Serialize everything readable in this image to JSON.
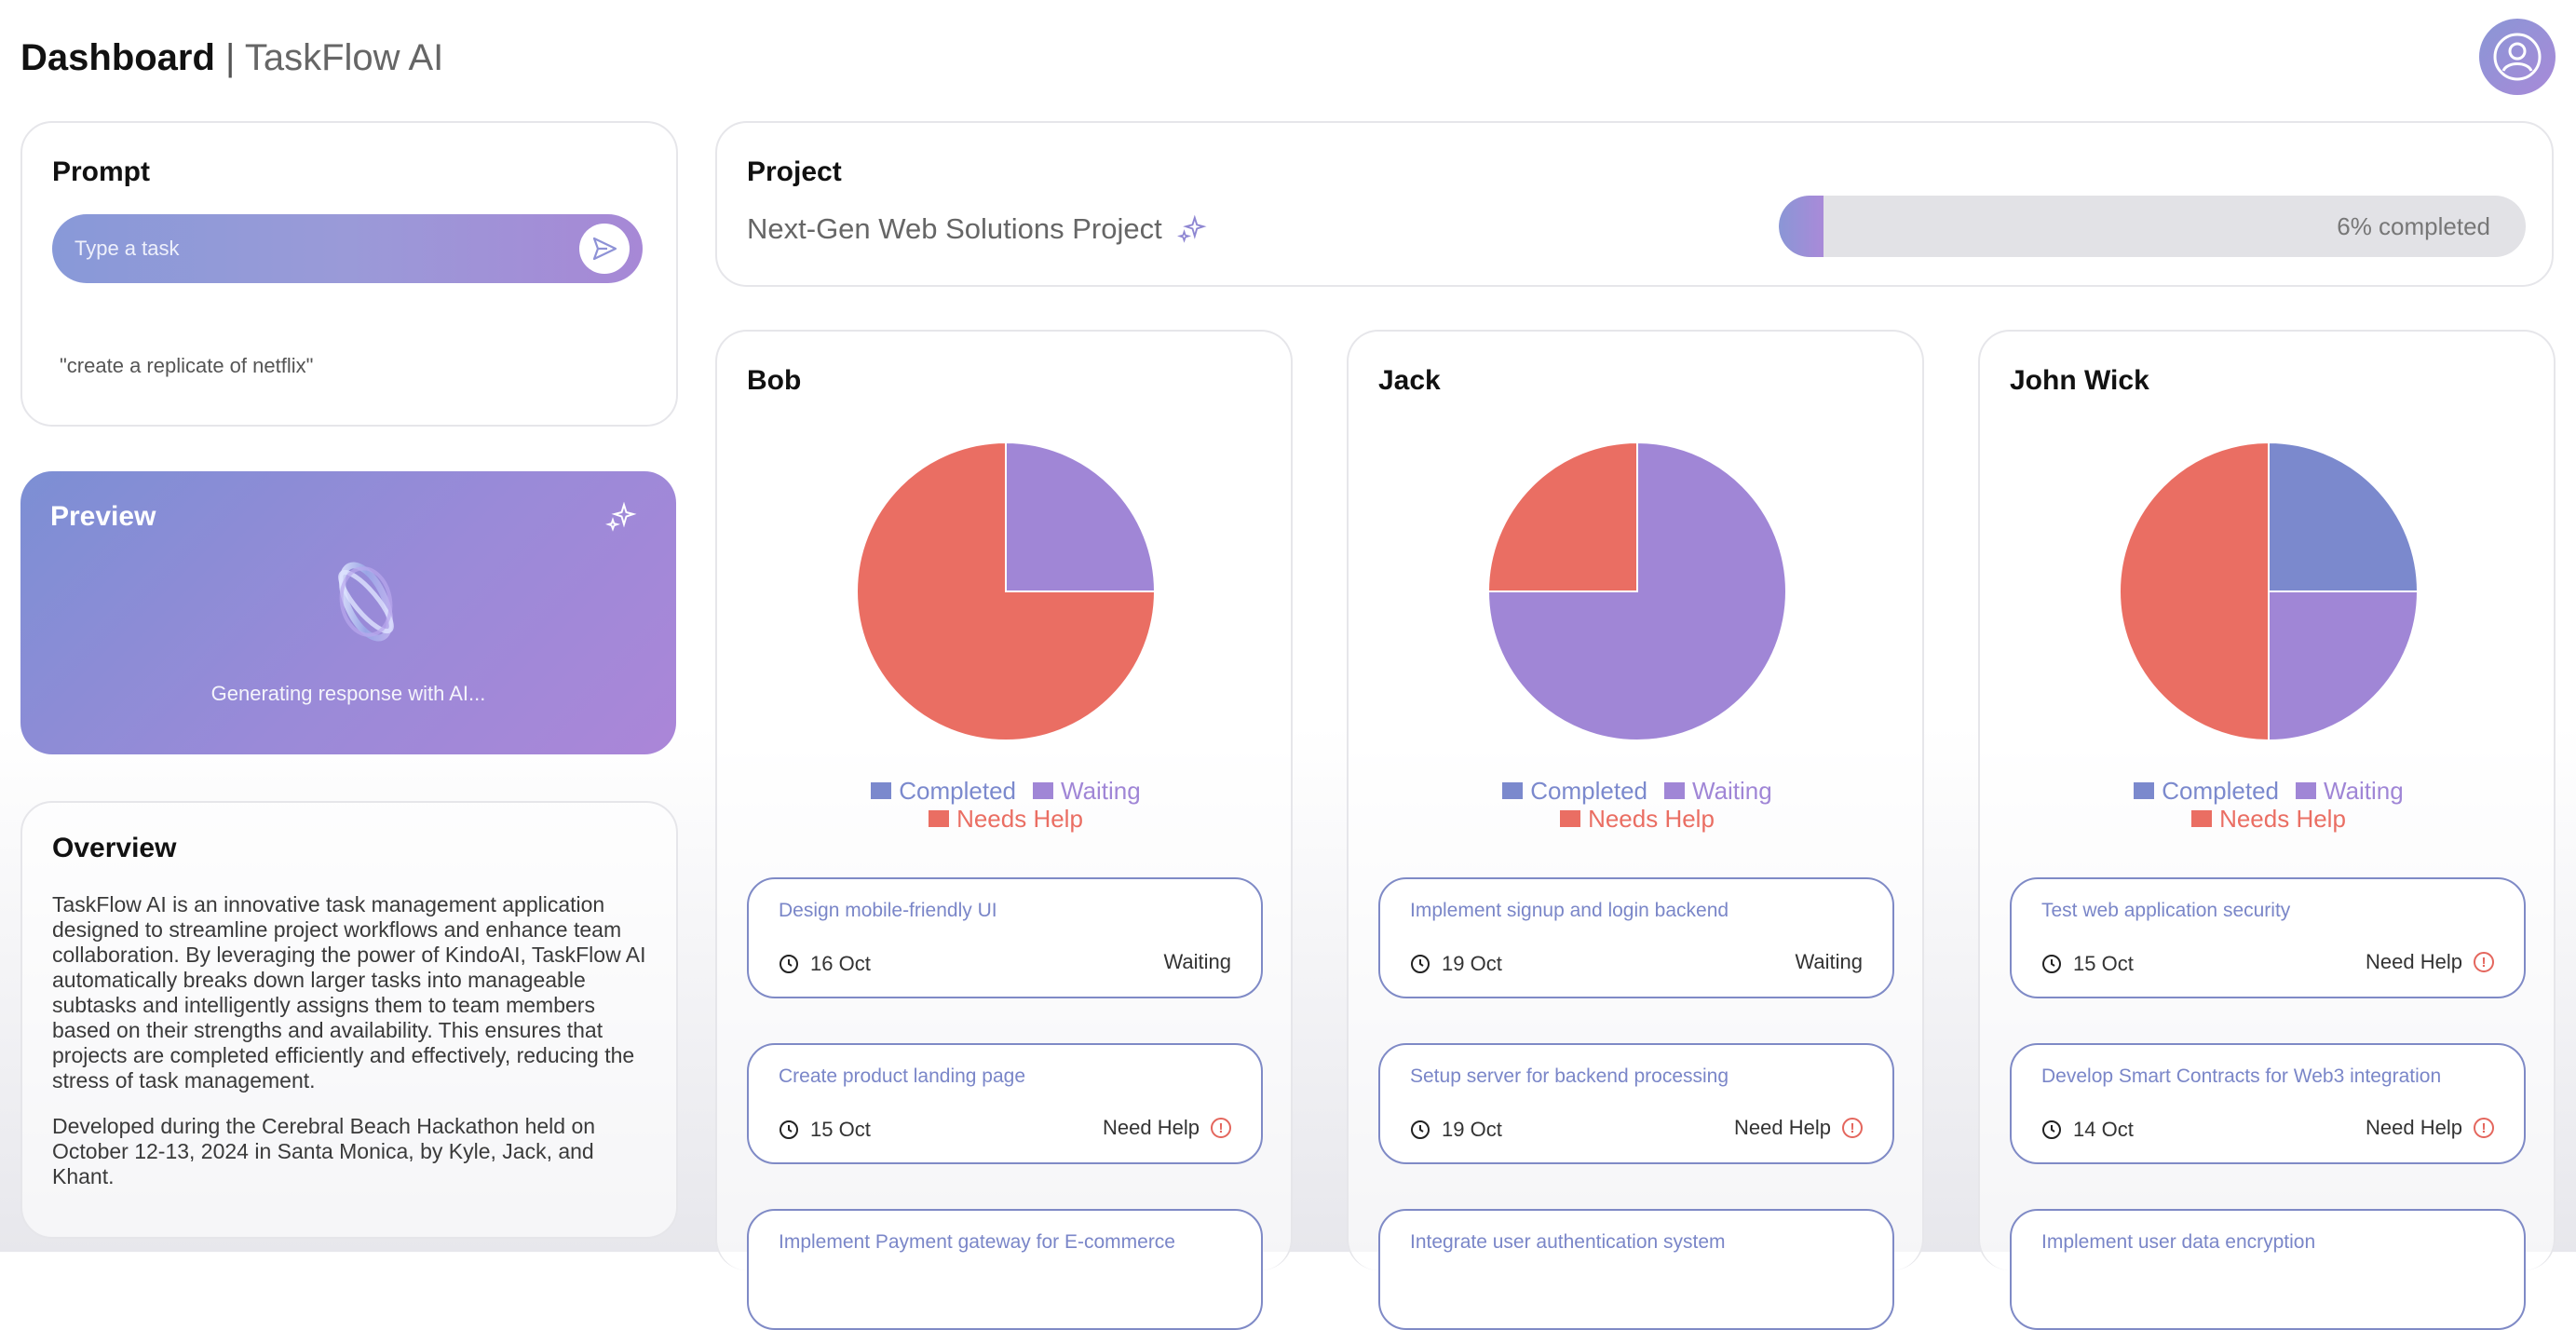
{
  "header": {
    "brand": "Dashboard",
    "separator": " | ",
    "app_name": "TaskFlow AI"
  },
  "prompt": {
    "title": "Prompt",
    "placeholder": "Type a task",
    "last_query": "\"create a replicate of netflix\""
  },
  "preview": {
    "title": "Preview",
    "status": "Generating response with AI..."
  },
  "overview": {
    "title": "Overview",
    "paragraph1": "TaskFlow AI is an innovative task management application designed to streamline project workflows and enhance team collaboration. By leveraging the power of KindoAI, TaskFlow AI automatically breaks down larger tasks into manageable subtasks and intelligently assigns them to team members based on their strengths and availability. This ensures that projects are completed efficiently and effectively, reducing the stress of task management.",
    "paragraph2": "Developed during the Cerebral Beach Hackathon held on October 12-13, 2024 in Santa Monica, by Kyle, Jack, and Khant."
  },
  "project": {
    "title": "Project",
    "name": "Next-Gen Web Solutions Project",
    "progress_percent": 6,
    "progress_label": "6% completed"
  },
  "legend": {
    "completed": "Completed",
    "waiting": "Waiting",
    "needs_help": "Needs Help"
  },
  "colors": {
    "completed": "#7b89cd",
    "waiting": "#a086d6",
    "needs_help": "#ea6e63",
    "accent": "#9a8fd7"
  },
  "members": [
    {
      "name": "Bob",
      "chart_data": {
        "type": "pie",
        "labels": [
          "Completed",
          "Waiting",
          "Needs Help"
        ],
        "values": [
          0,
          25,
          75
        ]
      },
      "tasks": [
        {
          "title": "Design mobile-friendly UI",
          "date": "16 Oct",
          "status": "Waiting"
        },
        {
          "title": "Create product landing page",
          "date": "15 Oct",
          "status": "Need Help"
        },
        {
          "title": "Implement Payment gateway for E-commerce",
          "date": "",
          "status": ""
        }
      ]
    },
    {
      "name": "Jack",
      "chart_data": {
        "type": "pie",
        "labels": [
          "Completed",
          "Waiting",
          "Needs Help"
        ],
        "values": [
          0,
          75,
          25
        ]
      },
      "tasks": [
        {
          "title": "Implement signup and login backend",
          "date": "19 Oct",
          "status": "Waiting"
        },
        {
          "title": "Setup server for backend processing",
          "date": "19 Oct",
          "status": "Need Help"
        },
        {
          "title": "Integrate user authentication system",
          "date": "",
          "status": ""
        }
      ]
    },
    {
      "name": "John Wick",
      "chart_data": {
        "type": "pie",
        "labels": [
          "Completed",
          "Waiting",
          "Needs Help"
        ],
        "values": [
          25,
          25,
          50
        ]
      },
      "tasks": [
        {
          "title": "Test web application security",
          "date": "15 Oct",
          "status": "Need Help"
        },
        {
          "title": "Develop Smart Contracts for Web3 integration",
          "date": "14 Oct",
          "status": "Need Help"
        },
        {
          "title": "Implement user data encryption",
          "date": "",
          "status": ""
        }
      ]
    }
  ]
}
